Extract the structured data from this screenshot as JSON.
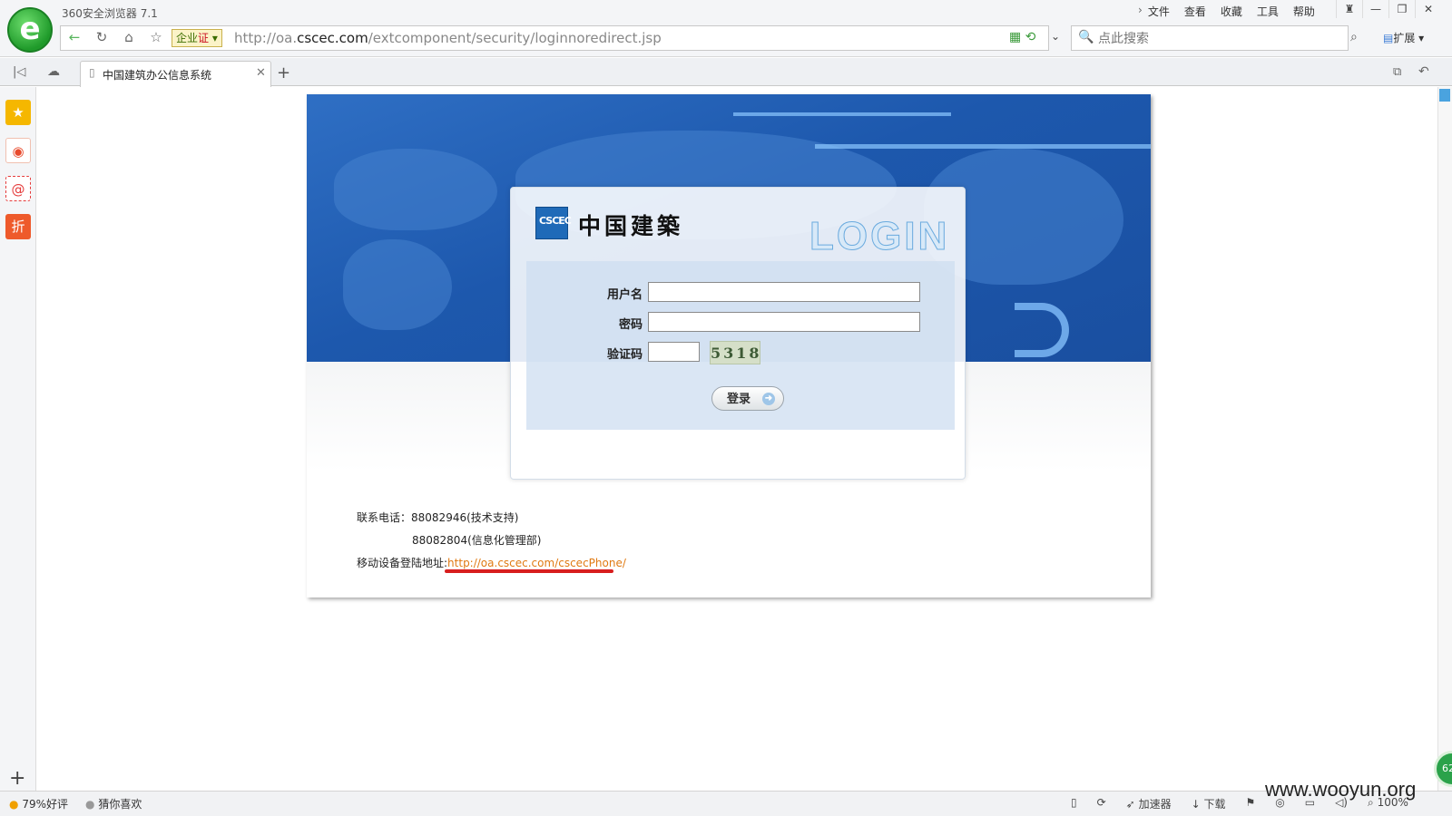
{
  "browser": {
    "app_title": "360安全浏览器 7.1",
    "menu": [
      "文件",
      "查看",
      "收藏",
      "工具",
      "帮助"
    ],
    "enterprise_badge": "企业",
    "enterprise_cert": "证",
    "url_prefix": "http://oa.",
    "url_domain": "cscec.com",
    "url_path": "/extcomponent/security/loginnoredirect.jsp",
    "search_placeholder": "点此搜索",
    "extensions_label": "扩展",
    "tab_title": "中国建筑办公信息系统"
  },
  "sidebar": {
    "items": [
      {
        "icon": "star-icon",
        "color": "#f5b700"
      },
      {
        "icon": "weibo-icon",
        "color": "#e84a2c"
      },
      {
        "icon": "mail-icon",
        "color": "#e53b3b",
        "glyph": "@"
      },
      {
        "icon": "discount-icon",
        "color": "#ee5a2b",
        "glyph": "折"
      }
    ]
  },
  "login": {
    "brand_name": "中国建築",
    "logo_text": "CSCEC",
    "login_word": "LOGIN",
    "username_label": "用户名",
    "password_label": "密码",
    "captcha_label": "验证码",
    "captcha_code": "5318",
    "submit_label": "登录",
    "contact_label": "联系电话：",
    "phone_1": "88082946(技术支持)",
    "phone_2": "88082804(信息化管理部)",
    "mobile_label": "移动设备登陆地址:",
    "mobile_url": "http://oa.cscec.com/cscecPhone/"
  },
  "status": {
    "rating": "79%好评",
    "guess_like": "猜你喜欢",
    "accelerator": "加速器",
    "download": "下载",
    "zoom": "100%",
    "float_ball": "62",
    "watermark": "www.wooyun.org"
  }
}
